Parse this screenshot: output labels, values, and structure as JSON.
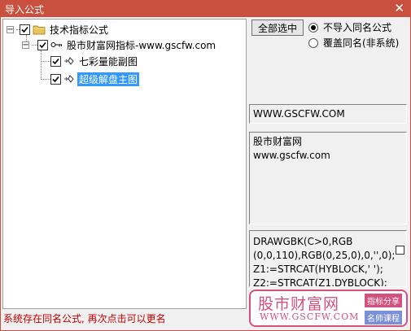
{
  "window": {
    "title": "导入公式",
    "close_glyph": "✕"
  },
  "tree": {
    "root": {
      "label": "技术指标公式",
      "expand_glyph": "−"
    },
    "group": {
      "label": "股市财富网指标-www.gscfw.com",
      "expand_glyph": "−"
    },
    "items": [
      {
        "label": "七彩量能副图"
      },
      {
        "label": "超级解盘主图"
      }
    ]
  },
  "buttons": {
    "select_all": "全部选中"
  },
  "options": {
    "no_import": "不导入同名公式",
    "overwrite": "覆盖同名(非系统)",
    "selected": "no_import"
  },
  "panels": {
    "url": "WWW.GSCFW.COM",
    "desc_line1": "股市财富网",
    "desc_line2": "www.gscfw.com",
    "code_line1": "DRAWGBK(C>0,RGB",
    "code_line2": "(0,0,110),RGB(0,25,0),0,'',0);",
    "code_line3": "Z1:=STRCAT(HYBLOCK,' ');",
    "code_line4": "Z2:=STRCAT(Z1,DYBLOCK);"
  },
  "status": {
    "message": "系统存在同名公式, 再次点击可以更名"
  },
  "watermark": {
    "brand": "股市财富网",
    "url": "WWW.GSCFW.COM",
    "tag1": "指标分享",
    "tag2": "名师课程"
  },
  "colors": {
    "titlebar": "#c9503f",
    "selection": "#3399ff",
    "status": "#c00000",
    "watermark": "#d4507e"
  }
}
